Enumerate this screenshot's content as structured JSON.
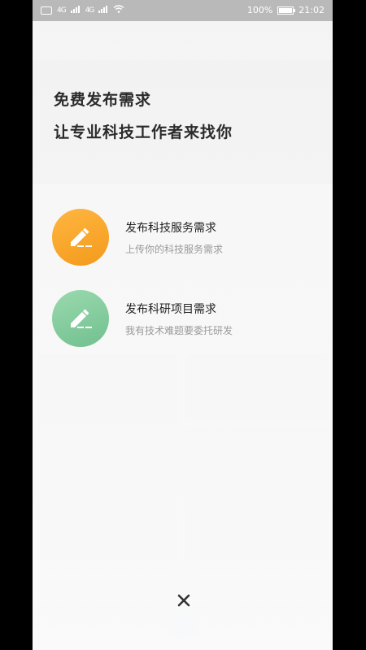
{
  "status_bar": {
    "left_labels": [
      "4G",
      "4G"
    ],
    "battery": "100%",
    "time": "21:02",
    "battery_level": 1.0
  },
  "headline": {
    "line1": "免费发布需求",
    "line2": "让专业科技工作者来找你"
  },
  "options": [
    {
      "title": "发布科技服务需求",
      "subtitle": "上传你的科技服务需求",
      "icon": "pencil-icon",
      "color": "#f7a62a"
    },
    {
      "title": "发布科研项目需求",
      "subtitle": "我有技术难题要委托研发",
      "icon": "pencil-icon",
      "color": "#7ec999"
    }
  ],
  "close": {
    "icon": "close-icon"
  }
}
